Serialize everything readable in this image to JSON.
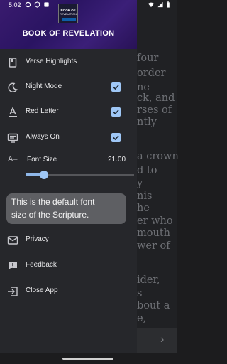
{
  "status_bar": {
    "time": "5:02"
  },
  "drawer": {
    "logo": {
      "line1": "BOOK OF",
      "line2": "REVELATION"
    },
    "title": "BOOK OF REVELATION",
    "items": [
      {
        "label": "Verse Highlights",
        "icon": "book-icon",
        "checked": null
      },
      {
        "label": "Night Mode",
        "icon": "moon-icon",
        "checked": true
      },
      {
        "label": "Red Letter",
        "icon": "text-format-icon",
        "checked": true
      },
      {
        "label": "Always On",
        "icon": "screen-icon",
        "checked": true
      }
    ],
    "font_size": {
      "icon": "A–",
      "label": "Font Size",
      "value": "21.00",
      "level_fraction": 0.17
    },
    "tooltip": {
      "line1": "This is the default font",
      "line2": "size of the Scripture."
    },
    "bottom_items": [
      {
        "label": "Privacy",
        "icon": "mail-icon"
      },
      {
        "label": "Feedback",
        "icon": "feedback-icon"
      },
      {
        "label": "Close App",
        "icon": "exit-icon"
      }
    ]
  },
  "reader_lines": [
    "four",
    "order",
    "ne",
    "ck, and",
    "rses of",
    "ntly",
    "a crown",
    "d to",
    "y",
    "nis",
    "he",
    "er who",
    "mouth",
    "wer of",
    "ider,",
    "s",
    "bout a",
    "e,"
  ],
  "colors": {
    "accent": "#9fc7f6",
    "header": "#2a1462",
    "drawer_bg": "#26272b"
  }
}
